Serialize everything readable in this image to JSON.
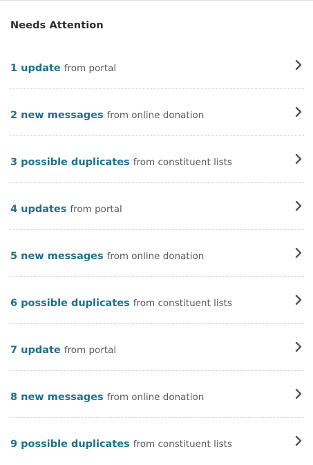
{
  "panel": {
    "title": "Needs Attention"
  },
  "items": [
    {
      "count": "1 update",
      "source": "from portal"
    },
    {
      "count": "2 new messages",
      "source": "from online donation"
    },
    {
      "count": "3 possible duplicates",
      "source": "from constituent lists"
    },
    {
      "count": "4 updates",
      "source": "from portal"
    },
    {
      "count": "5 new messages",
      "source": "from online donation"
    },
    {
      "count": "6 possible duplicates",
      "source": "from constituent lists"
    },
    {
      "count": "7 update",
      "source": "from portal"
    },
    {
      "count": "8 new messages",
      "source": "from online donation"
    },
    {
      "count": "9 possible duplicates",
      "source": "from constituent lists"
    }
  ],
  "colors": {
    "link": "#1f6f8b",
    "secondary_text": "#5a5a5a",
    "heading": "#2b2b2b",
    "chevron": "#555555",
    "divider": "#c8c8c8"
  },
  "icons": {
    "row_action": "chevron-right-icon"
  }
}
